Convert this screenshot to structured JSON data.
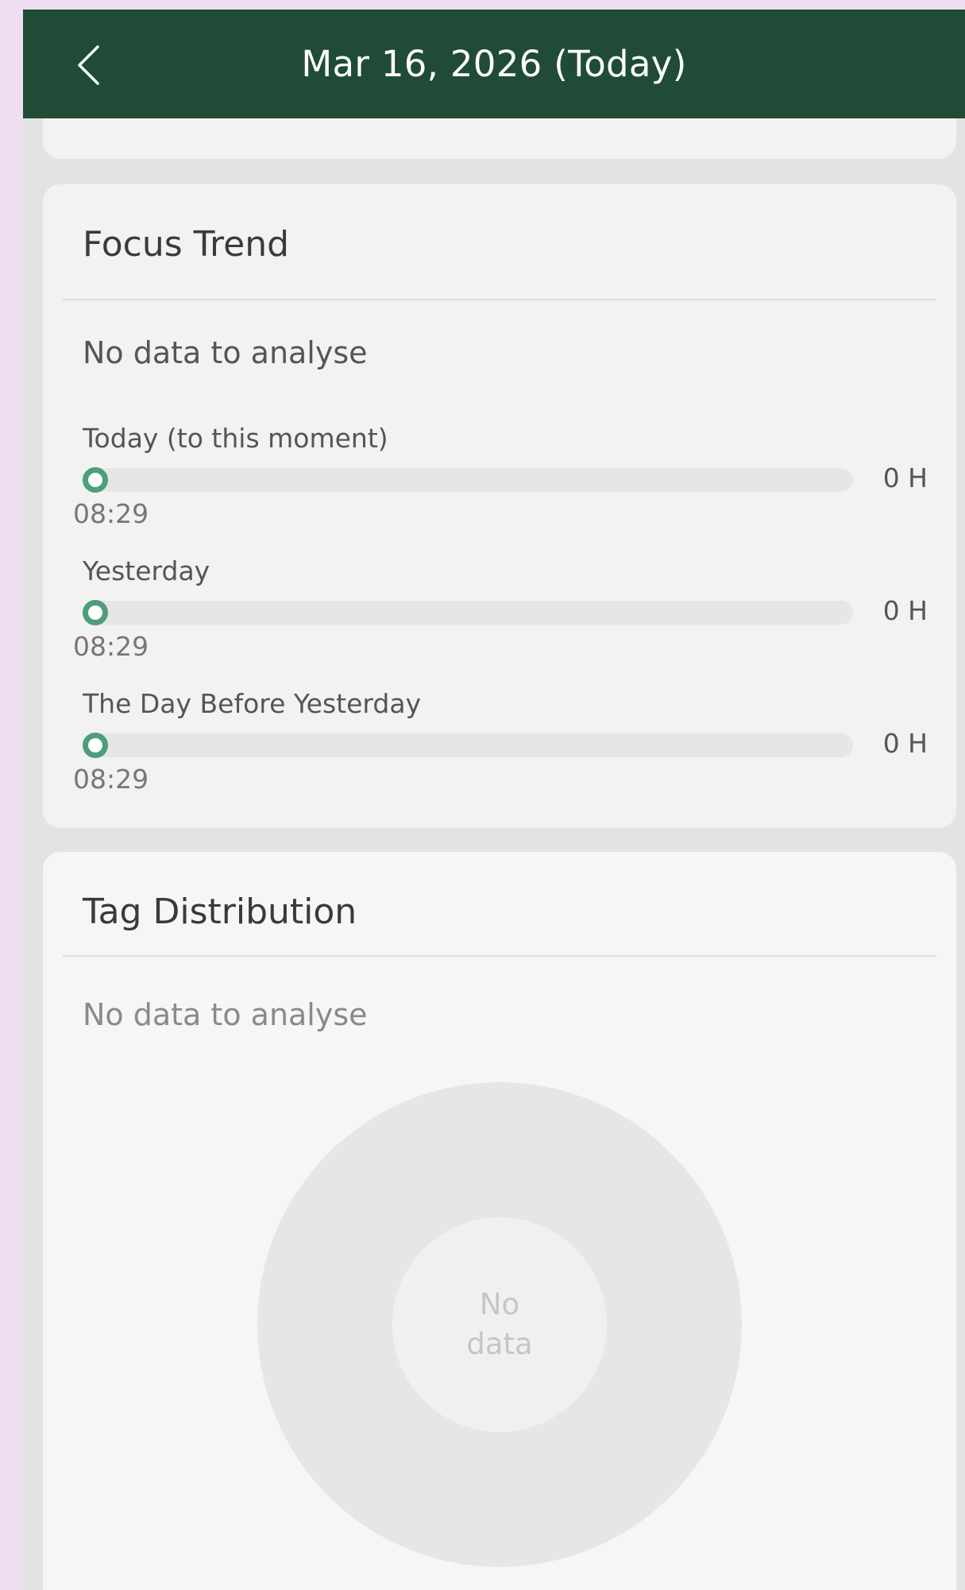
{
  "header": {
    "title": "Mar 16, 2026 (Today)",
    "back_icon": "chevron-left-icon"
  },
  "focus_trend": {
    "title": "Focus Trend",
    "no_data": "No data to analyse",
    "accent_color": "#4e9e7a",
    "rows": [
      {
        "label": "Today (to this moment)",
        "value": "0 H",
        "time": "08:29",
        "progress": 0
      },
      {
        "label": "Yesterday",
        "value": "0 H",
        "time": "08:29",
        "progress": 0
      },
      {
        "label": "The Day Before Yesterday",
        "value": "0 H",
        "time": "08:29",
        "progress": 0
      }
    ]
  },
  "tag_distribution": {
    "title": "Tag Distribution",
    "no_data": "No data to analyse",
    "donut_line1": "No",
    "donut_line2": "data"
  },
  "colors": {
    "header_bg": "#204b36",
    "page_bg": "#e3e3e3",
    "card_bg": "#f2f2f2"
  }
}
